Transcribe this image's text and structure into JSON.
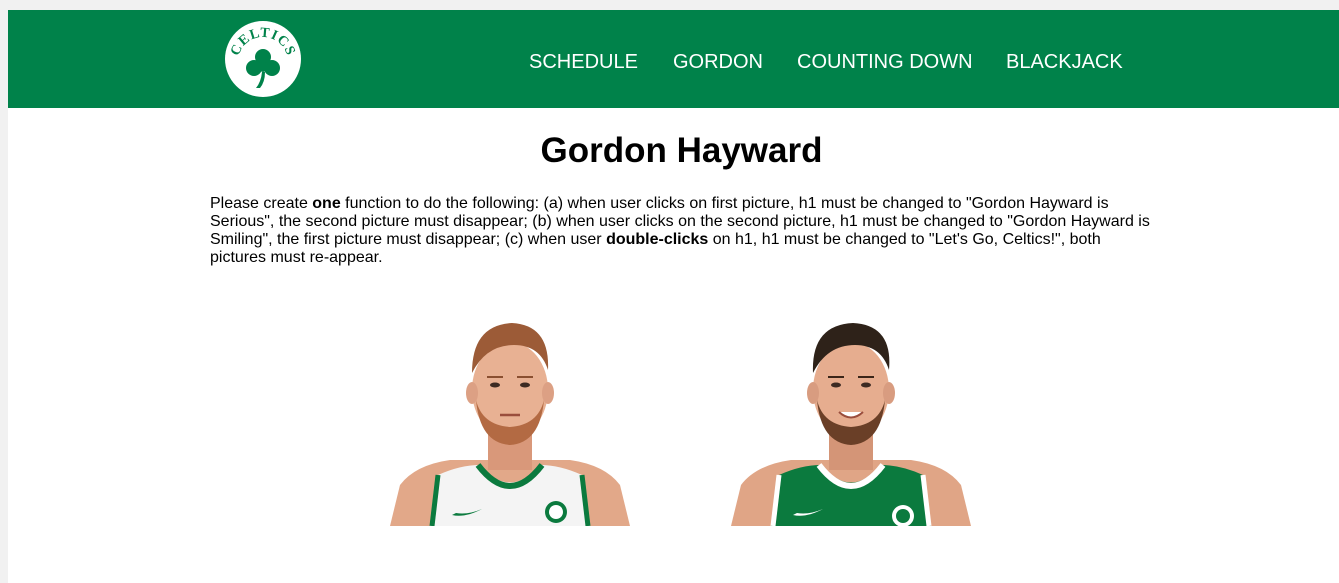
{
  "nav": {
    "logo_text": "CELTICS",
    "items": [
      {
        "label": "SCHEDULE"
      },
      {
        "label": "GORDON"
      },
      {
        "label": "COUNTING DOWN"
      },
      {
        "label": "BLACKJACK"
      }
    ]
  },
  "main": {
    "heading": "Gordon Hayward",
    "instructions": {
      "p1": "Please create ",
      "b1": "one",
      "p2": " function to do the following: (a) when user clicks on first picture, h1 must be changed to \"Gordon Hayward is Serious\", the second picture must disappear; (b) when user clicks on the second picture, h1 must be changed to \"Gordon Hayward is Smiling\", the first picture must disappear; (c) when user ",
      "b2": "double-clicks",
      "p3": " on h1, h1 must be changed to \"Let's Go, Celtics!\", both pictures must re-appear."
    }
  },
  "colors": {
    "brand_green": "#00824a",
    "jersey_white": "#f4f4f4",
    "jersey_green": "#0b7a3e"
  }
}
